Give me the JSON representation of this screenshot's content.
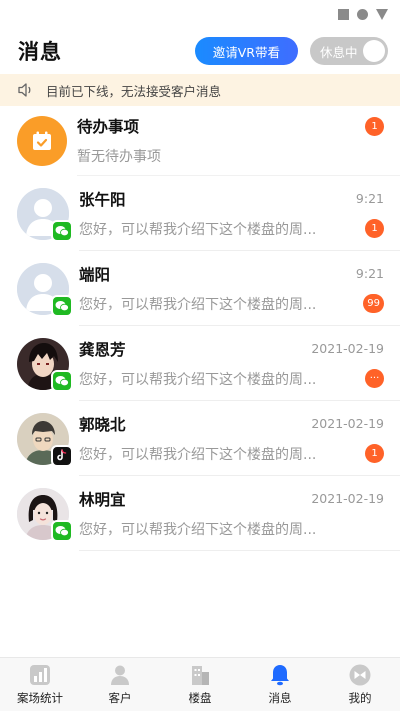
{
  "header": {
    "title": "消息",
    "invite_label": "邀请VR带看",
    "rest_label": "休息中"
  },
  "notice": {
    "text": "目前已下线，无法接受客户消息"
  },
  "todo": {
    "name": "待办事项",
    "preview": "暂无待办事项",
    "count": "1"
  },
  "conversations": [
    {
      "name": "张午阳",
      "time": "9:21",
      "preview": "您好，可以帮我介绍下这个楼盘的周...",
      "count": "1",
      "source": "wechat"
    },
    {
      "name": "端阳",
      "time": "9:21",
      "preview": "您好，可以帮我介绍下这个楼盘的周...",
      "count": "99",
      "source": "wechat"
    },
    {
      "name": "龚恩芳",
      "time": "2021-02-19",
      "preview": "您好，可以帮我介绍下这个楼盘的周...",
      "count": "···",
      "source": "wechat"
    },
    {
      "name": "郭晓北",
      "time": "2021-02-19",
      "preview": "您好，可以帮我介绍下这个楼盘的周...",
      "count": "1",
      "source": "tiktok"
    },
    {
      "name": "林明宜",
      "time": "2021-02-19",
      "preview": "您好，可以帮我介绍下这个楼盘的周...",
      "count": "",
      "source": "wechat"
    }
  ],
  "tabs": [
    {
      "label": "案场统计",
      "icon": "chart-icon",
      "active": false
    },
    {
      "label": "客户",
      "icon": "person-icon",
      "active": false
    },
    {
      "label": "楼盘",
      "icon": "building-icon",
      "active": false
    },
    {
      "label": "消息",
      "icon": "bell-icon",
      "active": true
    },
    {
      "label": "我的",
      "icon": "profile-icon",
      "active": false
    }
  ],
  "colors": {
    "accent": "#1a8bff",
    "badge": "#ff6228",
    "todo": "#fa9d28",
    "notice_bg": "#fdf3e2"
  }
}
